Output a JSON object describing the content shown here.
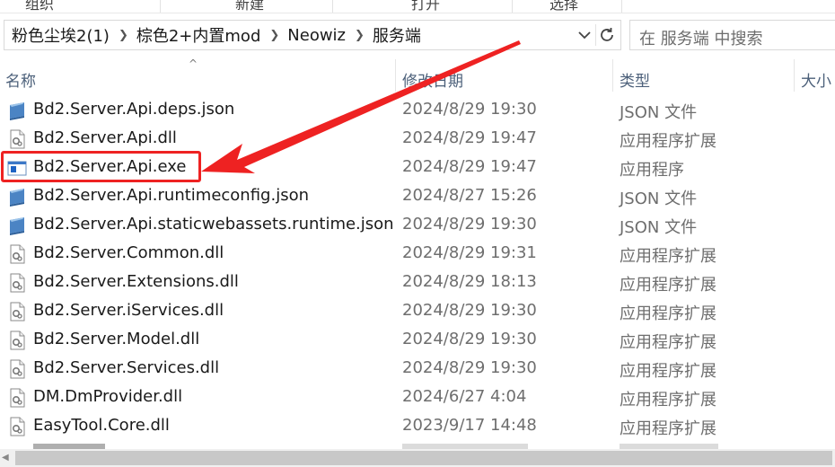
{
  "ribbon": {
    "items": [
      "组织",
      "新建",
      "打开",
      "选择"
    ]
  },
  "address": {
    "crumbs": [
      "粉色尘埃2(1)",
      "棕色2+内置mod",
      "Neowiz",
      "服务端"
    ]
  },
  "search": {
    "placeholder": "在 服务端 中搜索"
  },
  "columns": {
    "name": "名称",
    "date": "修改日期",
    "type": "类型",
    "size": "大小"
  },
  "files": [
    {
      "name": "Bd2.Server.Api.deps.json",
      "date": "2024/8/29 19:30",
      "type": "JSON 文件",
      "icon": "json-file-icon"
    },
    {
      "name": "Bd2.Server.Api.dll",
      "date": "2024/8/29 19:47",
      "type": "应用程序扩展",
      "icon": "dll-file-icon"
    },
    {
      "name": "Bd2.Server.Api.exe",
      "date": "2024/8/29 19:47",
      "type": "应用程序",
      "icon": "exe-file-icon"
    },
    {
      "name": "Bd2.Server.Api.runtimeconfig.json",
      "date": "2024/8/27 15:26",
      "type": "JSON 文件",
      "icon": "json-file-icon"
    },
    {
      "name": "Bd2.Server.Api.staticwebassets.runtime.json",
      "date": "2024/8/29 19:30",
      "type": "JSON 文件",
      "icon": "json-file-icon"
    },
    {
      "name": "Bd2.Server.Common.dll",
      "date": "2024/8/29 19:31",
      "type": "应用程序扩展",
      "icon": "dll-file-icon"
    },
    {
      "name": "Bd2.Server.Extensions.dll",
      "date": "2024/8/29 18:13",
      "type": "应用程序扩展",
      "icon": "dll-file-icon"
    },
    {
      "name": "Bd2.Server.iServices.dll",
      "date": "2024/8/29 19:30",
      "type": "应用程序扩展",
      "icon": "dll-file-icon"
    },
    {
      "name": "Bd2.Server.Model.dll",
      "date": "2024/8/29 19:30",
      "type": "应用程序扩展",
      "icon": "dll-file-icon"
    },
    {
      "name": "Bd2.Server.Services.dll",
      "date": "2024/8/29 19:30",
      "type": "应用程序扩展",
      "icon": "dll-file-icon"
    },
    {
      "name": "DM.DmProvider.dll",
      "date": "2024/6/27 4:04",
      "type": "应用程序扩展",
      "icon": "dll-file-icon"
    },
    {
      "name": "EasyTool.Core.dll",
      "date": "2023/9/17 14:48",
      "type": "应用程序扩展",
      "icon": "dll-file-icon"
    }
  ],
  "colors": {
    "highlight": "#ee2222",
    "header_text": "#4c607a",
    "date_text": "#6e6e6e"
  }
}
